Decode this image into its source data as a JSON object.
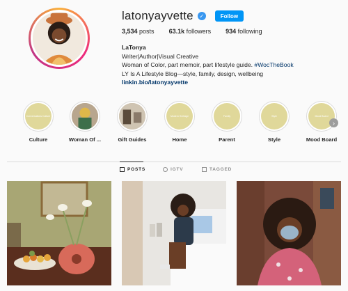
{
  "profile": {
    "username": "latonyayvette",
    "verified_icon": "verified-badge-icon",
    "follow_label": "Follow",
    "accent_color": "#0095f6"
  },
  "stats": {
    "posts": "3,534",
    "posts_label": "posts",
    "followers": "63.1k",
    "followers_label": "followers",
    "following": "934",
    "following_label": "following"
  },
  "bio": {
    "name": "LaTonya",
    "line1": "Writer|Author|Visual Creative",
    "line2_text": "Woman of Color, part memoir, part lifestyle guide. ",
    "line2_tag": "#WocTheBook",
    "line3": "LY Is A Lifestyle Blog—style, family, design, wellbeing",
    "link": "linkin.bio/latonyayvette"
  },
  "highlights": [
    {
      "label": "Culture",
      "cover_text": "Conversations Culture"
    },
    {
      "label": "Woman Of ...",
      "cover_text": ""
    },
    {
      "label": "Gift Guides",
      "cover_text": ""
    },
    {
      "label": "Home",
      "cover_text": "Modern Heritage"
    },
    {
      "label": "Parent",
      "cover_text": "Family"
    },
    {
      "label": "Style",
      "cover_text": "Style"
    },
    {
      "label": "Mood Board",
      "cover_text": "Mood Board"
    }
  ],
  "tabs": [
    {
      "label": "POSTS",
      "active": true
    },
    {
      "label": "IGTV",
      "active": false
    },
    {
      "label": "TAGGED",
      "active": false
    }
  ],
  "posts": [
    {
      "subject": "still life with tulips, vase and fruit bowl"
    },
    {
      "subject": "woman sitting on bed"
    },
    {
      "subject": "woman in mask on city street"
    }
  ]
}
